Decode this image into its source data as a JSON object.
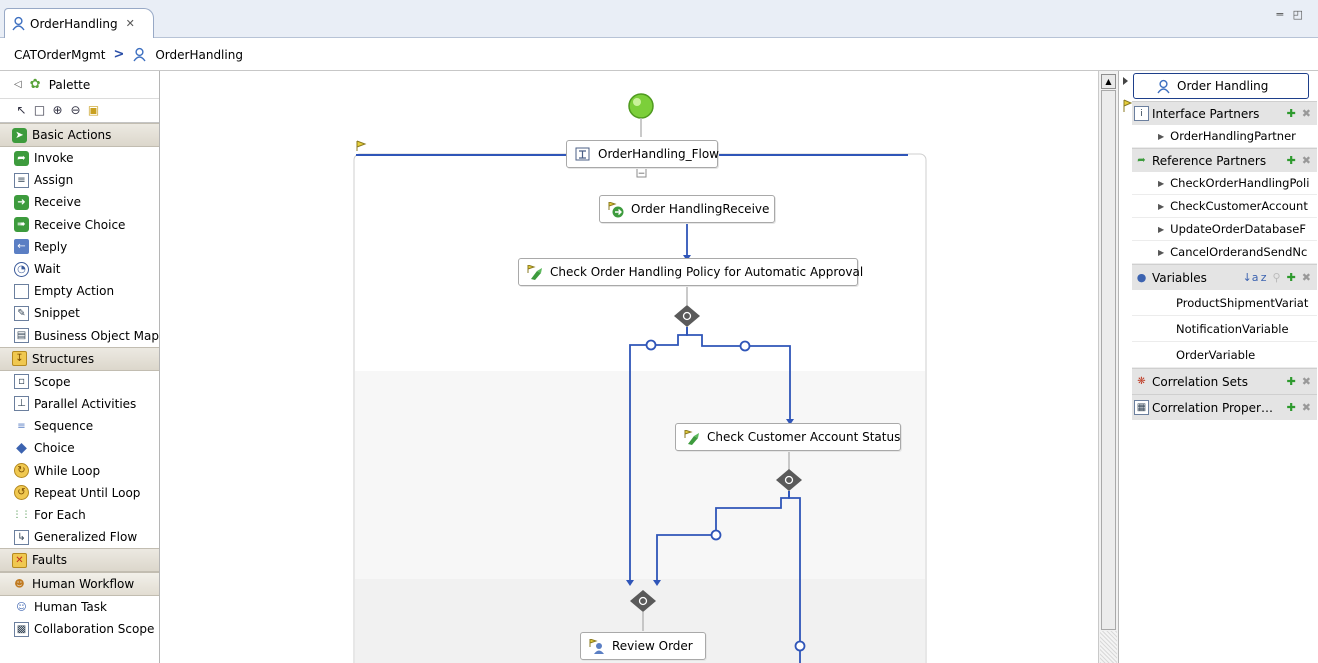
{
  "editor_tab": {
    "title": "OrderHandling",
    "close": "✕",
    "window_controls": "═ ◰"
  },
  "breadcrumb": {
    "parent": "CATOrderMgmt",
    "separator": ">",
    "current": "OrderHandling"
  },
  "palette": {
    "title": "Palette",
    "drawers": {
      "basic_actions": "Basic Actions",
      "structures": "Structures",
      "faults": "Faults",
      "human_workflow": "Human Workflow"
    },
    "basic_items": [
      {
        "label": "Invoke",
        "icon": "invoke-icon"
      },
      {
        "label": "Assign",
        "icon": "assign-icon"
      },
      {
        "label": "Receive",
        "icon": "receive-icon"
      },
      {
        "label": "Receive Choice",
        "icon": "receive-choice-icon"
      },
      {
        "label": "Reply",
        "icon": "reply-icon"
      },
      {
        "label": "Wait",
        "icon": "wait-icon"
      },
      {
        "label": "Empty Action",
        "icon": "empty-action-icon"
      },
      {
        "label": "Snippet",
        "icon": "snippet-icon"
      },
      {
        "label": "Business Object Map",
        "icon": "business-object-map-icon"
      }
    ],
    "structure_items": [
      {
        "label": "Scope",
        "icon": "scope-icon"
      },
      {
        "label": "Parallel Activities",
        "icon": "parallel-activities-icon"
      },
      {
        "label": "Sequence",
        "icon": "sequence-icon"
      },
      {
        "label": "Choice",
        "icon": "choice-icon"
      },
      {
        "label": "While Loop",
        "icon": "while-loop-icon"
      },
      {
        "label": "Repeat Until Loop",
        "icon": "repeat-until-loop-icon"
      },
      {
        "label": "For Each",
        "icon": "for-each-icon"
      },
      {
        "label": "Generalized Flow",
        "icon": "generalized-flow-icon"
      }
    ],
    "human_items": [
      {
        "label": "Human Task",
        "icon": "human-task-icon"
      },
      {
        "label": "Collaboration Scope",
        "icon": "collaboration-scope-icon"
      }
    ]
  },
  "canvas": {
    "flow_label": "OrderHandling_Flow",
    "collapse_symbol": "−",
    "nodes": {
      "receive": "Order HandlingReceive",
      "check_policy": "Check Order Handling Policy for Automatic Approval",
      "check_account": "Check Customer Account Status",
      "review_order": "Review Order"
    }
  },
  "tray": {
    "title": "Order Handling",
    "interface_partners": {
      "label": "Interface Partners",
      "items": [
        "OrderHandlingPartner"
      ]
    },
    "reference_partners": {
      "label": "Reference Partners",
      "items": [
        "CheckOrderHandlingPoli",
        "CheckCustomerAccount",
        "UpdateOrderDatabaseF",
        "CancelOrderandSendNc"
      ]
    },
    "variables": {
      "label": "Variables",
      "items": [
        "ProductShipmentVariat",
        "NotificationVariable",
        "OrderVariable"
      ]
    },
    "correlation_sets": {
      "label": "Correlation Sets"
    },
    "correlation_properties": {
      "label": "Correlation Proper…"
    },
    "plus": "✚",
    "remove": "✖"
  },
  "colors": {
    "connector": "#2f55b8",
    "start_node": "#7ccf3a",
    "decision": "#5a5a5a",
    "tray_title_border": "#1e3f8a"
  }
}
